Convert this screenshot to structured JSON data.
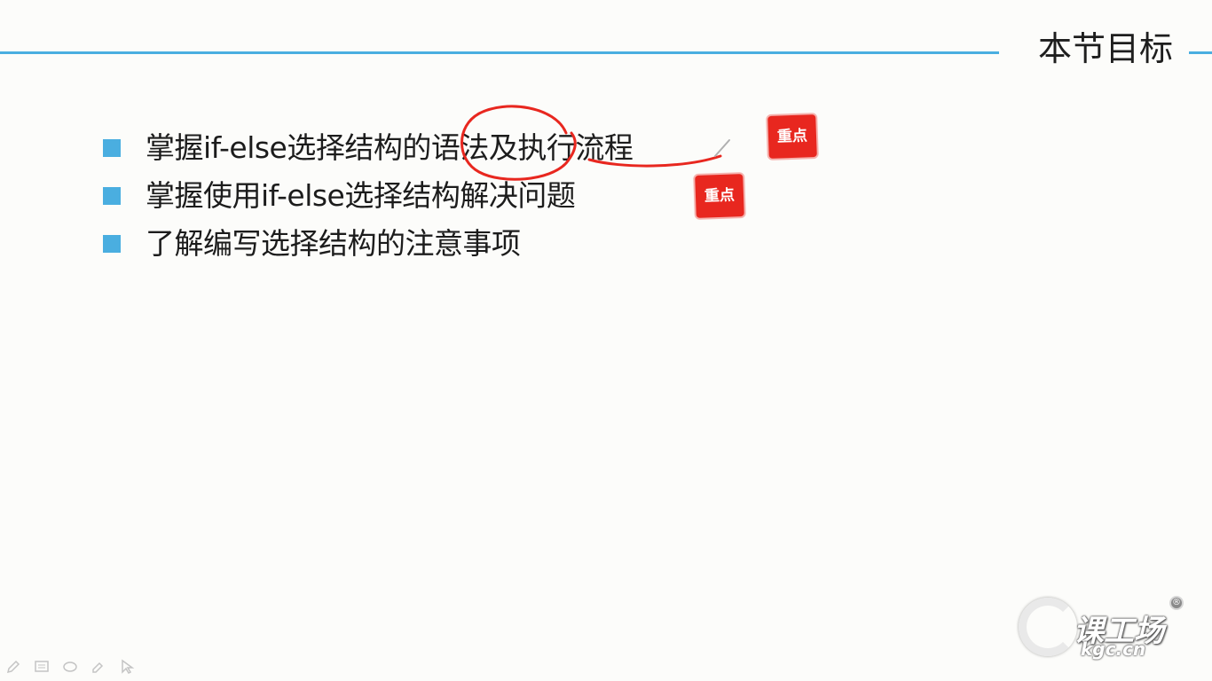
{
  "slide": {
    "title": "本节目标",
    "bullets": [
      "掌握if-else选择结构的语法及执行流程",
      "掌握使用if-else选择结构解决问题",
      "了解编写选择结构的注意事项"
    ],
    "stamps": [
      "重点",
      "重点"
    ]
  },
  "colors": {
    "accent": "#4aaee0",
    "stamp": "#e8271f",
    "annotation": "#e8271f"
  },
  "toolbar": {
    "tools": [
      "pen-icon",
      "screen-icon",
      "eraser-icon",
      "highlighter-icon",
      "pointer-icon"
    ]
  },
  "logo": {
    "name": "课工场",
    "url": "kgc.cn",
    "registered": "®"
  }
}
